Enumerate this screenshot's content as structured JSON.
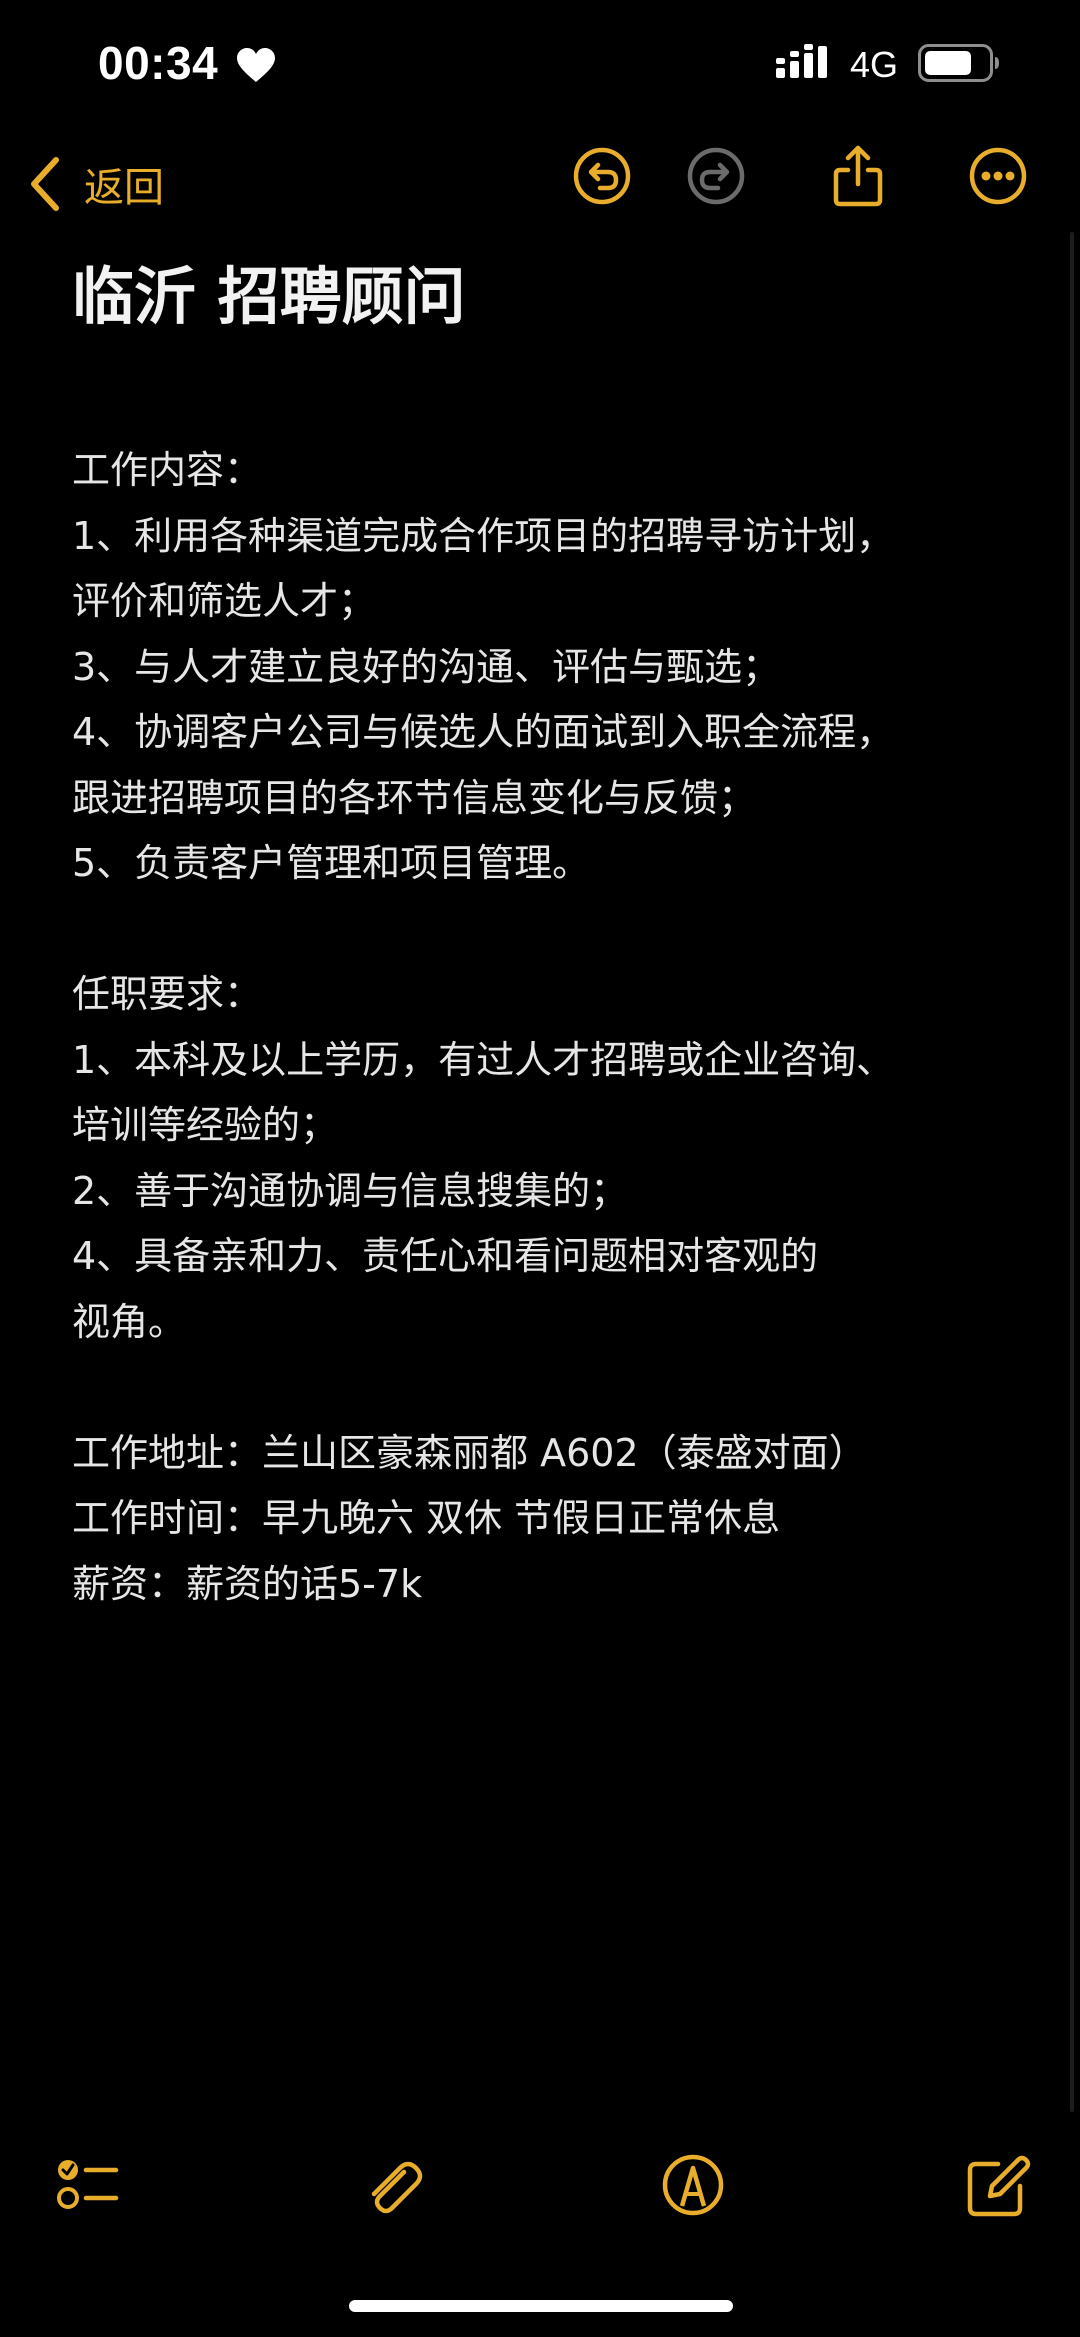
{
  "status_bar": {
    "time": "00:34",
    "network": "4G",
    "icons": [
      "heart-icon",
      "signal-icon",
      "battery-icon"
    ]
  },
  "nav": {
    "back_label": "返回",
    "icons": [
      "undo-icon",
      "redo-icon",
      "share-icon",
      "more-icon"
    ]
  },
  "note": {
    "title": "临沂 招聘顾问",
    "section_duties": {
      "heading": "工作内容：",
      "lines": [
        "1、利用各种渠道完成合作项目的招聘寻访计划，",
        "评价和筛选人才；",
        "3、与人才建立良好的沟通、评估与甄选；",
        "4、协调客户公司与候选人的面试到入职全流程，",
        "跟进招聘项目的各环节信息变化与反馈；",
        "5、负责客户管理和项目管理。"
      ]
    },
    "section_requirements": {
      "heading": "任职要求：",
      "lines": [
        "1、本科及以上学历，有过人才招聘或企业咨询、",
        "培训等经验的；",
        "2、善于沟通协调与信息搜集的；",
        "4、具备亲和力、责任心和看问题相对客观的",
        "视角。"
      ]
    },
    "section_info": {
      "address": "工作地址：兰山区豪森丽都 A602（泰盛对面）",
      "hours": "工作时间：早九晚六 双休 节假日正常休息",
      "salary": "薪资：薪资的话5-7k"
    }
  },
  "toolbar": {
    "icons": [
      "checklist-icon",
      "attachment-icon",
      "markup-icon",
      "compose-icon"
    ]
  },
  "colors": {
    "accent": "#e7ad2b",
    "background": "#000000",
    "text": "#e6e6e6",
    "disabled": "#6b6b6b"
  }
}
